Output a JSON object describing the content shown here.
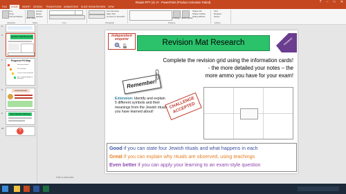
{
  "window": {
    "title": "Rituals PPT (4) .R - PowerPoint (Product Activation Failed)",
    "controls": [
      "?",
      "–",
      "□",
      "✕"
    ]
  },
  "tabs": [
    "FILE",
    "HOME",
    "INSERT",
    "DESIGN",
    "TRANSITIONS",
    "ANIMATIONS",
    "SLIDE SHOW",
    "REVIEW",
    "VIEW"
  ],
  "ribbon": {
    "clipboard": {
      "cut": "Cut",
      "copy": "Copy",
      "format_painter": "Format Painter",
      "label": "Clipboard"
    },
    "slides": {
      "new_slide": "New Slide",
      "layout": "Layout",
      "reset": "Reset",
      "section": "Section",
      "label": "Slides"
    },
    "font": {
      "label": "Font"
    },
    "paragraph": {
      "text_direction": "Text Direction",
      "align_text": "Align Text",
      "convert_smartart": "Convert to SmartArt",
      "label": "Paragraph"
    },
    "drawing": {
      "arrange": "Arrange",
      "quick_styles": "Quick Styles",
      "shape_fill": "Shape Fill",
      "shape_outline": "Shape Outline",
      "shape_effects": "Shape Effects",
      "label": "Drawing"
    },
    "editing": {
      "find": "Find",
      "replace": "Replace",
      "select": "Select",
      "label": "Editing"
    }
  },
  "thumbnails": {
    "numbers": [
      "5",
      "6",
      "7",
      "8",
      "9",
      "10"
    ],
    "slide6_title": "Revision Mat Research",
    "slide7_title": "Progress Pit Stop",
    "slide7_lines": [
      "How have we learnt?",
      "Do I need help?",
      "Do you not have any questions?",
      "Are YOU making progress in this lesson?"
    ],
    "slide8_title": "Jewish Rituals",
    "slide9_title": "Exam Question Planning"
  },
  "slide": {
    "badge": [
      "Independent",
      "enquirer"
    ],
    "title": "Revision Mat Research",
    "corner_tag": "Construct",
    "instruction_line1": "Complete the revision grid using the information cards!",
    "instruction_line2": "- the more detailed your notes – the",
    "instruction_line3": "more ammo you have for your exam!",
    "remember": "Remember!",
    "extension_label": "Extension:",
    "extension_text": " Identify and explain 5 different symbols and their meanings from the Jewish rituals you have learned about!",
    "stamp_line1": "CHALLENGE",
    "stamp_line2": "ACCEPTED",
    "good_word": "Good",
    "good_text": " if you can state four Jewish rituals and what happens in each",
    "great_word": "Great",
    "great_text": " if you can explain why rituals are observed, using teachings",
    "better_word": "Even better",
    "better_text": " if you can apply your learning to an exam-style question"
  },
  "notes_placeholder": "Click to add notes",
  "colors": {
    "accent": "#c5471f",
    "title_green": "#2bc26b",
    "purple": "#6a3d8f",
    "good": "#3a4fa0",
    "great": "#e67e22",
    "better": "#8e44ad",
    "extension": "#2a7d9c"
  }
}
